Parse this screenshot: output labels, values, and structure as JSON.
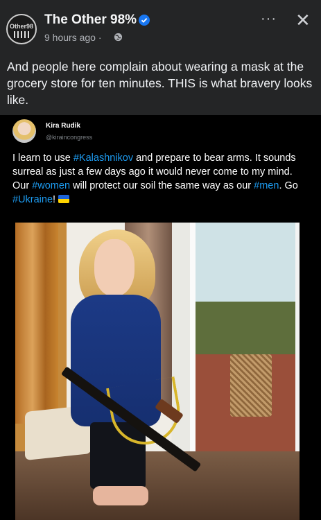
{
  "post": {
    "page_name": "The Other 98%",
    "page_logo_text": "Other98",
    "timestamp": "9 hours ago ·",
    "more_label": "···",
    "close_label": "✕",
    "caption": "And people here complain about wearing a mask at the grocery store for ten minutes. THIS is what bravery looks like."
  },
  "shared": {
    "author_name": "Kira Rudik",
    "author_handle": "@kiraincongress",
    "text_parts": {
      "p1": "I learn to use ",
      "tag1": "#Kalashnikov",
      "p2": " and prepare to bear arms. It sounds surreal as just a few days ago it would never come to my mind. Our ",
      "tag2": "#women",
      "p3": " will protect our soil the same way as our ",
      "tag3": "#men",
      "p4": ". Go ",
      "tag4": "#Ukraine",
      "p5": "! "
    }
  },
  "colors": {
    "background": "#242526",
    "hashtag": "#1d9bf0",
    "verified": "#1877f2"
  },
  "icons": [
    "verified-badge-icon",
    "globe-icon",
    "more-icon",
    "close-icon",
    "ukraine-flag-icon"
  ]
}
